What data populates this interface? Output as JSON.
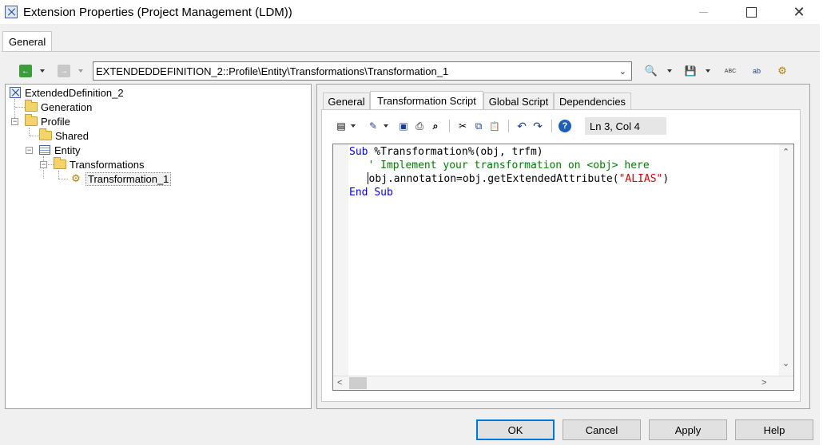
{
  "window": {
    "title": "Extension Properties (Project Management (LDM))",
    "close_glyph": "✕"
  },
  "outer_tabs": [
    {
      "label": "General"
    }
  ],
  "nav": {
    "back_glyph": "←",
    "forward_glyph": "→",
    "path": "EXTENDEDDEFINITION_2::Profile\\Entity\\Transformations\\Transformation_1",
    "combo_chevron": "⌄",
    "find_glyph": "🔍",
    "save_glyph": "💾",
    "spell_glyph": "ABC",
    "replace_glyph": "ab",
    "properties_glyph": "⚙"
  },
  "tree": {
    "root": "ExtendedDefinition_2",
    "items": [
      {
        "label": "Generation"
      },
      {
        "label": "Profile"
      },
      {
        "label": "Shared"
      },
      {
        "label": "Entity"
      },
      {
        "label": "Transformations"
      },
      {
        "label": "Transformation_1"
      }
    ],
    "expander_minus": "−"
  },
  "inner_tabs": [
    {
      "label": "General"
    },
    {
      "label": "Transformation Script"
    },
    {
      "label": "Global Script"
    },
    {
      "label": "Dependencies"
    }
  ],
  "editor": {
    "status": "Ln 3, Col 4",
    "tools": {
      "menu": "▤",
      "edit": "✎",
      "save": "▣",
      "print": "⎙",
      "find": "⌕",
      "cut": "✂",
      "copy": "⧉",
      "paste": "📋",
      "undo": "↶",
      "redo": "↷",
      "help": "?"
    },
    "code": {
      "line1_kw": "Sub",
      "line1_rest": " %Transformation%(obj, trfm)",
      "line2_comment": "   ' Implement your transformation on <obj> here",
      "line3_a": "bj.annotation=obj.getExtendedAttribute(",
      "line3_lead": "o",
      "line3_str": "\"ALIAS\"",
      "line3_end": ")",
      "line4_kw1": "End",
      "line4_kw2": "Sub"
    },
    "scroll_up": "⌃",
    "scroll_down": "⌄",
    "scroll_left": "<",
    "scroll_right": ">"
  },
  "buttons": {
    "ok": "OK",
    "cancel": "Cancel",
    "apply": "Apply",
    "help": "Help"
  },
  "colors": {
    "keyword": "#0000ff",
    "comment": "#008000",
    "string": "#e00000",
    "default_button_border": "#0078d7"
  }
}
